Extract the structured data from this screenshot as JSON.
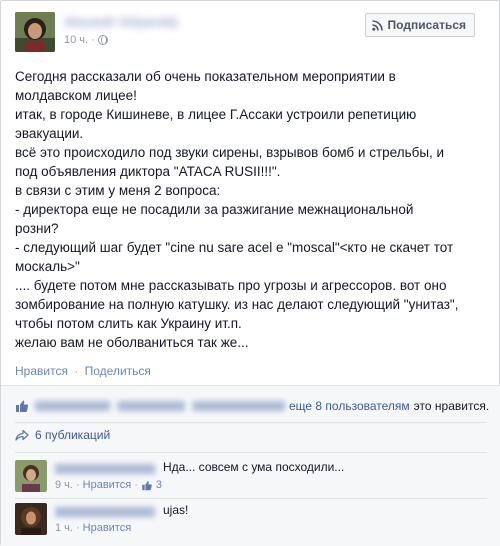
{
  "post": {
    "author_name": "Alexandr Volyanskij",
    "time": "10 ч.",
    "subscribe_label": "Подписаться",
    "text_lines": [
      "Сегодня рассказали об очень показательном мероприятии в",
      "молдавском лицее!",
      "итак, в городе Кишиневе, в лицее Г.Ассаки устроили репетицию",
      "эвакуации.",
      "всё это происходило под звуки сирены, взрывов бомб и стрельбы, и",
      "под объявления диктора \"ATACA RUSII!!!\".",
      "в связи с этим у меня 2 вопроса:",
      "- директора еще не посадили за разжигание межнациональной",
      "розни?",
      "- следующий шаг будет \"cine nu sare acel e \"moscal\"<кто не скачет тот",
      "москаль>\"",
      " .... будете потом мне рассказывать про угрозы и агрессоров. вот оно",
      "зомбирование на полную катушку. из нас делают следующий \"унитаз\",",
      "чтобы потом слить как Украину ит.п.",
      "желаю вам не оболваниться так же..."
    ],
    "like_label": "Нравится",
    "share_label": "Поделиться",
    "separator": "·"
  },
  "ufi": {
    "likers": "Bemis N. Frederic, Mos Tanzschule",
    "more_likes_link": "еще 8 пользователям",
    "likes_tail": "это нравится.",
    "shares_count": "6 публикаций"
  },
  "comments": [
    {
      "author": "Natalya Ruszova",
      "text": "Нда... совсем с ума посходили...",
      "time": "9 ч.",
      "like_label": "Нравится",
      "like_count": "3"
    },
    {
      "author": "Marianna Ferez",
      "text": "ujas!",
      "time": "1 ч.",
      "like_label": "Нравится"
    }
  ],
  "colors": {
    "link": "#3b5998",
    "muted_link": "#6d84b4",
    "meta": "#9197a3",
    "text": "#141823",
    "ufi_bg": "#f6f7f9"
  }
}
